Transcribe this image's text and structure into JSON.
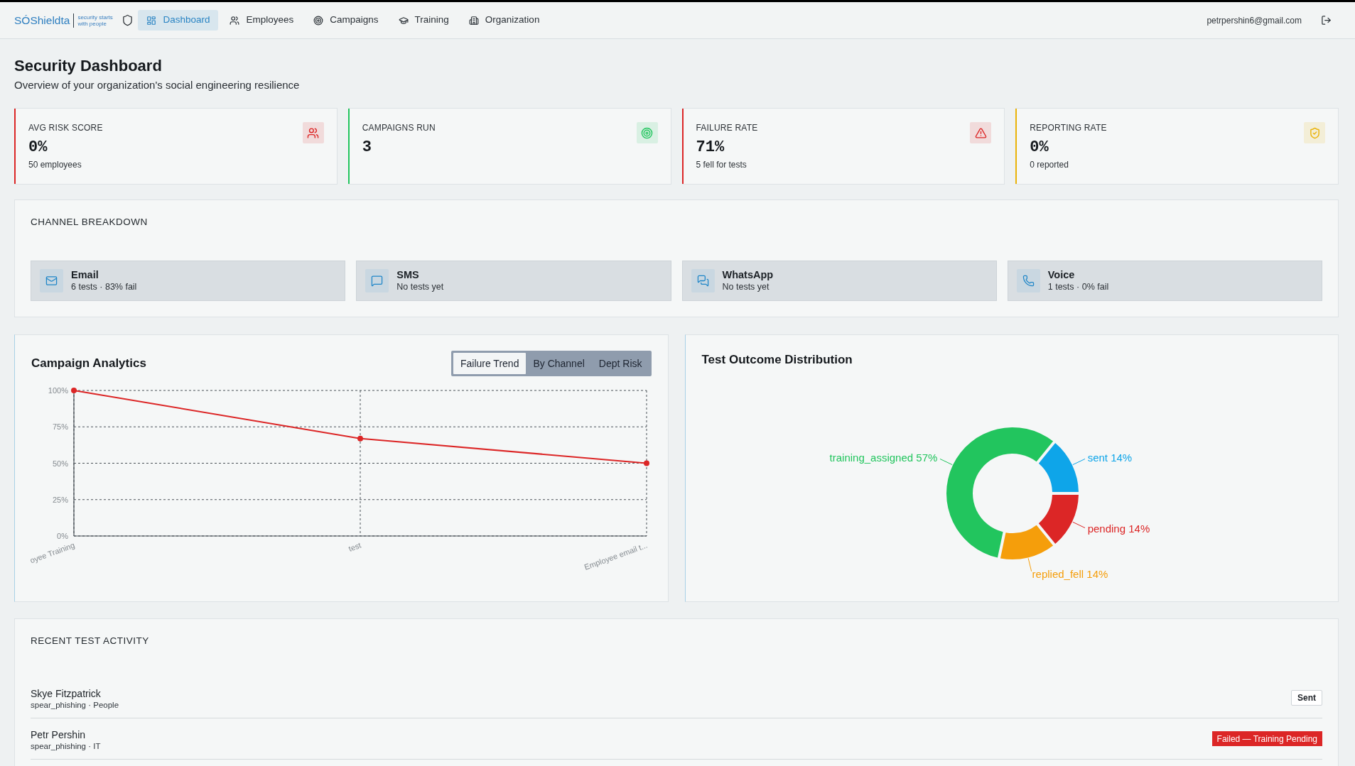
{
  "header": {
    "brand": {
      "name": "SÓShieldta",
      "tagline": "security starts with people"
    },
    "nav": [
      {
        "label": "Dashboard",
        "selected": true
      },
      {
        "label": "Employees",
        "selected": false
      },
      {
        "label": "Campaigns",
        "selected": false
      },
      {
        "label": "Training",
        "selected": false
      },
      {
        "label": "Organization",
        "selected": false
      }
    ],
    "user_email": "petrpershin6@gmail.com"
  },
  "page": {
    "title": "Security Dashboard",
    "subtitle": "Overview of your organization's social engineering resilience"
  },
  "stat_cards": [
    {
      "label": "AVG RISK SCORE",
      "value": "0%",
      "detail": "50 employees",
      "color": "#dc2626"
    },
    {
      "label": "CAMPAIGNS RUN",
      "value": "3",
      "color": "#22c55e"
    },
    {
      "label": "FAILURE RATE",
      "value": "71%",
      "detail": "5 fell for tests",
      "color": "#dc2626"
    },
    {
      "label": "REPORTING RATE",
      "value": "0%",
      "detail": "0 reported",
      "color": "#eab308"
    }
  ],
  "channel_breakdown": {
    "title": "CHANNEL BREAKDOWN",
    "channels": [
      {
        "name": "Email",
        "summary": "6 tests · 83% fail"
      },
      {
        "name": "SMS",
        "summary": "No tests yet"
      },
      {
        "name": "WhatsApp",
        "summary": "No tests yet"
      },
      {
        "name": "Voice",
        "summary": "1 tests · 0% fail"
      }
    ]
  },
  "campaign_analytics": {
    "title": "Campaign Analytics",
    "tabs": [
      {
        "label": "Failure Trend",
        "selected": true
      },
      {
        "label": "By Channel",
        "selected": false
      },
      {
        "label": "Dept Risk",
        "selected": false
      }
    ],
    "chart_data": {
      "type": "line",
      "categories": [
        "oyee Training",
        "test",
        "Employee email t..."
      ],
      "series": [
        {
          "color": "#dc2626",
          "values": [
            100,
            67,
            50
          ],
          "marker": "circle"
        }
      ],
      "ylim": [
        0,
        100
      ],
      "yticks": [
        {
          "value": 0,
          "label": "0%"
        },
        {
          "value": 25,
          "label": "25%"
        },
        {
          "value": 50,
          "label": "50%"
        },
        {
          "value": 75,
          "label": "75%"
        },
        {
          "value": 100,
          "label": "100%"
        }
      ],
      "grid": true
    }
  },
  "outcome_distribution": {
    "title": "Test Outcome Distribution",
    "chart_data": {
      "type": "donut",
      "categories": [
        "sent",
        "training_assigned",
        "replied_fell",
        "pending"
      ],
      "values": [
        14,
        57,
        14,
        14
      ],
      "colors": [
        "#0ea5e9",
        "#22c55e",
        "#f59e0b",
        "#dc2626"
      ],
      "value_labels": [
        "14%",
        "57%",
        "14%",
        "14%"
      ]
    }
  },
  "recent_activity": {
    "title": "RECENT TEST ACTIVITY",
    "rows": [
      {
        "name": "Skye Fitzpatrick",
        "detail": "spear_phishing · People",
        "status": {
          "label": "Sent",
          "kind": "neutral"
        }
      },
      {
        "name": "Petr Pershin",
        "detail": "spear_phishing · IT",
        "status": {
          "label": "Failed — Training Pending",
          "kind": "danger"
        }
      }
    ]
  }
}
